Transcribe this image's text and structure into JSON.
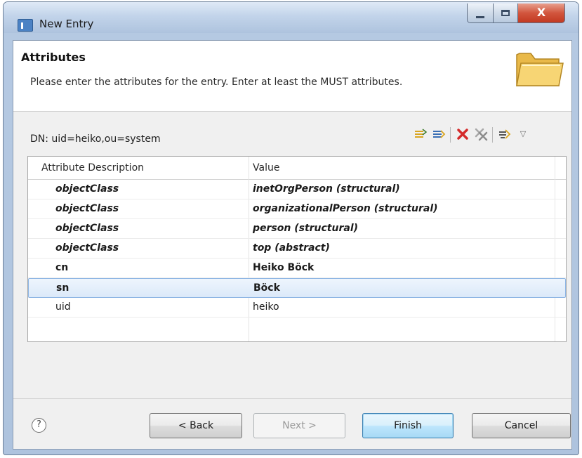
{
  "window": {
    "title": "New Entry",
    "controls": {
      "minimize": "",
      "maximize": "",
      "close": "X"
    }
  },
  "header": {
    "title": "Attributes",
    "description": "Please enter the attributes for the entry. Enter at least the MUST attributes.",
    "icon": "folder-icon"
  },
  "dn": {
    "label": "DN: uid=heiko,ou=system"
  },
  "toolbar": {
    "items": [
      "new-attribute-icon",
      "new-value-icon",
      "delete-icon",
      "delete-all-icon",
      "edit-value-icon",
      "view-menu-icon"
    ]
  },
  "table": {
    "columns": [
      "Attribute Description",
      "Value"
    ],
    "rows": [
      {
        "attribute": "objectClass",
        "value": "inetOrgPerson (structural)",
        "style": "bolditalic"
      },
      {
        "attribute": "objectClass",
        "value": "organizationalPerson (structural)",
        "style": "bolditalic"
      },
      {
        "attribute": "objectClass",
        "value": "person (structural)",
        "style": "bolditalic"
      },
      {
        "attribute": "objectClass",
        "value": "top (abstract)",
        "style": "bolditalic"
      },
      {
        "attribute": "cn",
        "value": "Heiko Böck",
        "style": "bold"
      },
      {
        "attribute": "sn",
        "value": "Böck",
        "style": "bold",
        "selected": true
      },
      {
        "attribute": "uid",
        "value": "heiko",
        "style": "normal"
      }
    ]
  },
  "buttons": {
    "help": "?",
    "back": "< Back",
    "next": "Next >",
    "finish": "Finish",
    "cancel": "Cancel"
  },
  "colors": {
    "selection": "#dbe9f9",
    "delete_red": "#d42a2a",
    "default_button": "#bee6fd"
  }
}
